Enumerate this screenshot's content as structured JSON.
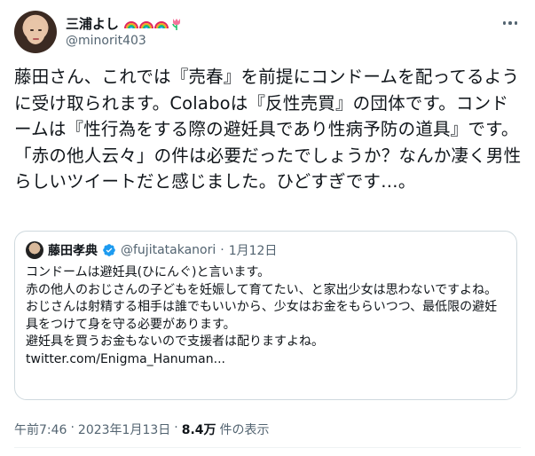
{
  "author": {
    "name": "三浦よし",
    "handle": "@minorit403",
    "emojis": [
      "rainbow-icon",
      "rainbow-icon",
      "rainbow-icon",
      "tulip-icon"
    ]
  },
  "tweet": {
    "text": "藤田さん、これでは『売春』を前提にコンドームを配ってるように受け取られます。Colaboは『反性売買』の団体です。コンドームは『性行為をする際の避妊具であり性病予防の道具』です。「赤の他人云々」の件は必要だったでしょうか？なんか凄く男性らしいツイートだと感じました。ひどすぎです…。"
  },
  "quote": {
    "name": "藤田孝典",
    "handle": "@fujitatakanori",
    "dot": "·",
    "date": "1月12日",
    "text": "コンドームは避妊具(ひにんぐ)と言います。\n赤の他人のおじさんの子どもを妊娠して育てたい、と家出少女は思わないですよね。\nおじさんは射精する相手は誰でもいいから、少女はお金をもらいつつ、最低限の避妊具をつけて身を守る必要があります。\n避妊具を買うお金もないので支援者は配りますよね。\ntwitter.com/Enigma_Hanuman..."
  },
  "meta": {
    "time": "午前7:46",
    "dot": "·",
    "date": "2023年1月13日",
    "dot2": "·",
    "views": "8.4万",
    "views_label": "件の表示"
  },
  "colors": {
    "text": "#0f1419",
    "muted": "#536471",
    "border": "#cfd9de",
    "verified": "#1d9bf0"
  }
}
